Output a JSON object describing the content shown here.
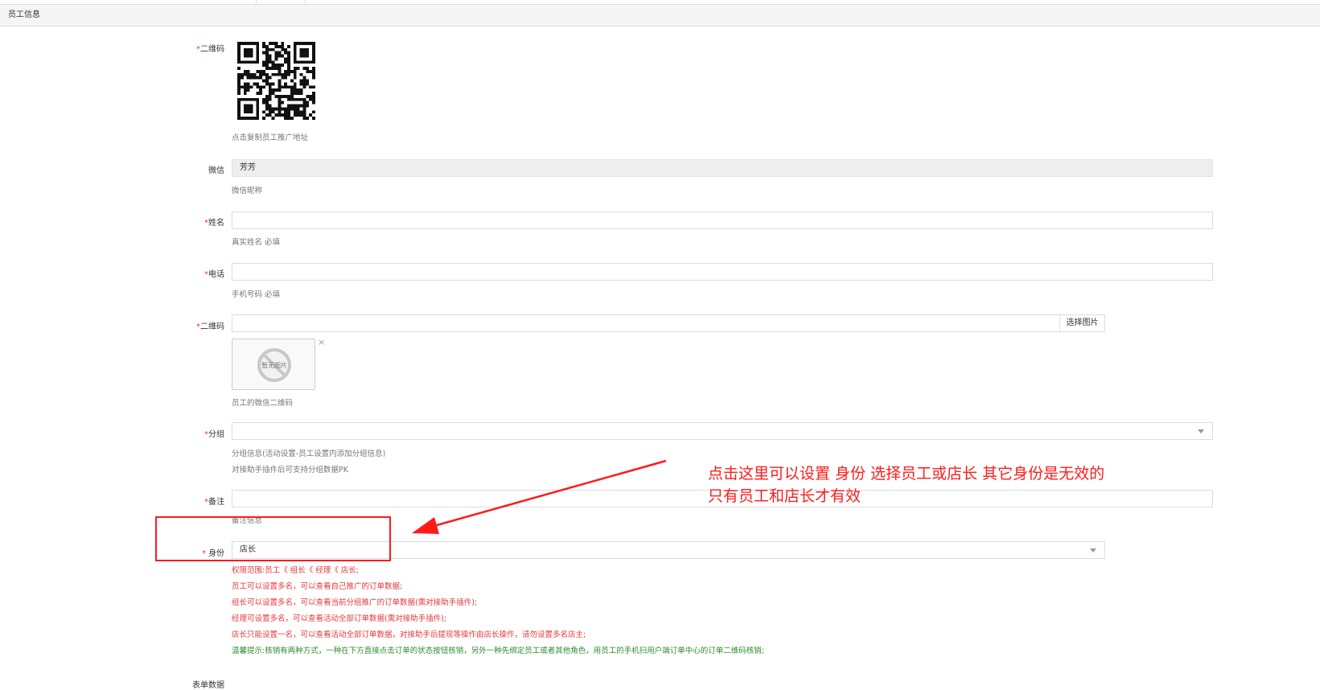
{
  "panel": {
    "title": "员工信息"
  },
  "fields": {
    "qrcode": {
      "label": "二维码",
      "help": "点击复制员工推广地址"
    },
    "wechat": {
      "label": "微信",
      "value": "芳芳",
      "help": "微信昵称"
    },
    "name": {
      "label": "姓名",
      "value": "",
      "help": "真实姓名 必填"
    },
    "phone": {
      "label": "电话",
      "value": "",
      "help": "手机号码 必填"
    },
    "qrcode_upload": {
      "label": "二维码",
      "value": "",
      "button": "选择图片",
      "thumb_text": "暂无图片",
      "remove": "×",
      "help": "员工的微信二维码"
    },
    "group": {
      "label": "分组",
      "value": "",
      "help1": "分组信息(活动设置-员工设置内添加分组信息)",
      "help2": "对接助手插件后可支持分组数据PK"
    },
    "remark": {
      "label": "备注",
      "value": "",
      "help": "备注信息"
    },
    "role": {
      "label": "身份",
      "value": "店长",
      "notes": [
        "权限范围:员工《 组长《 经理《 店长;",
        "员工可以设置多名，可以查看自己推广的订单数据;",
        "组长可以设置多名，可以查看当前分组推广的订单数据(需对接助手插件);",
        "经理可设置多名，可以查看活动全部订单数据(需对接助手插件);",
        "店长只能设置一名，可以查看活动全部订单数据，对接助手后提现等操作由店长操作，请勿设置多名店主;"
      ],
      "tip": "温馨提示:核销有两种方式，一种在下方直接点击订单的状态按钮核销，另外一种先绑定员工或者其他角色，用员工的手机扫用户端订单中心的订单二维码核销;"
    },
    "next_section": {
      "label": "表单数据"
    }
  },
  "required_mark": "*",
  "annotation": {
    "line1": "点击这里可以设置 身份 选择员工或店长  其它身份是无效的",
    "line2": "只有员工和店长才有效"
  },
  "colors": {
    "required": "#e4393c",
    "annotation": "#ff1a1a",
    "tip_green": "#2e8b2e"
  }
}
